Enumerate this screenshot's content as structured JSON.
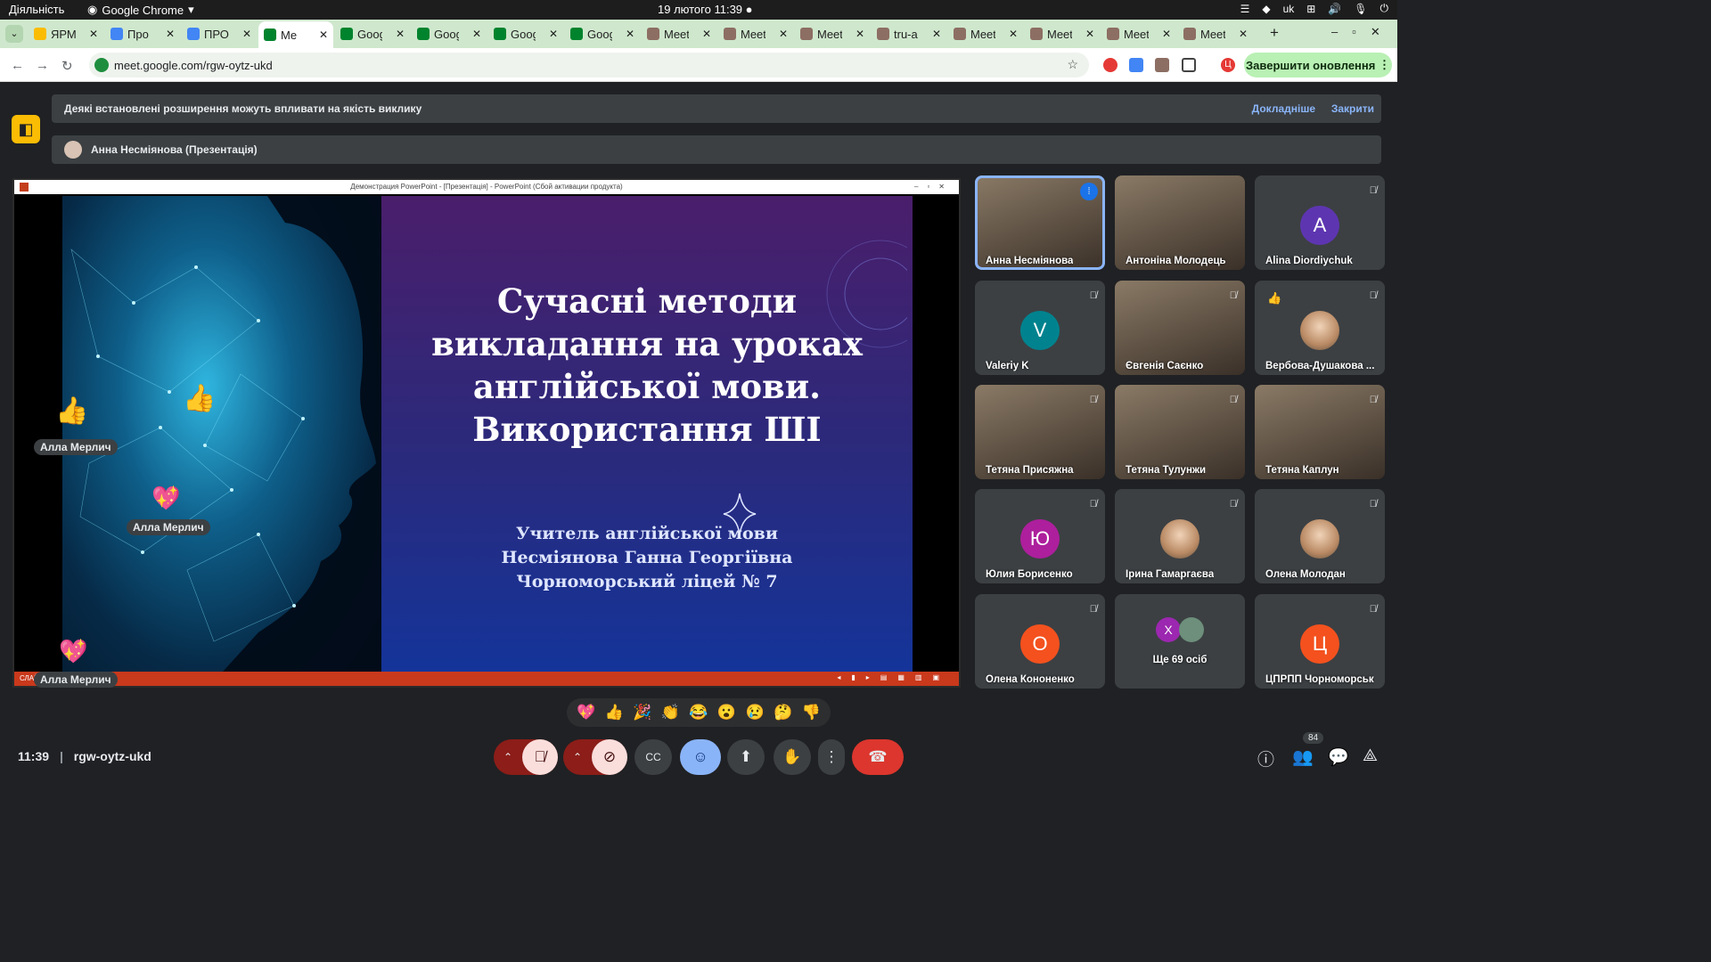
{
  "system": {
    "activities": "Діяльність",
    "app": "Google Chrome",
    "clock": "19 лютого  11:39",
    "lang": "uk"
  },
  "tabs": [
    {
      "title": "ЯРМ",
      "color": "#fbbc04"
    },
    {
      "title": "Про",
      "color": "#4285f4"
    },
    {
      "title": "ПРОІ",
      "color": "#4285f4"
    },
    {
      "title": "Me",
      "color": "#00832d",
      "active": true
    },
    {
      "title": "Goog",
      "color": "#00832d"
    },
    {
      "title": "Goog",
      "color": "#00832d"
    },
    {
      "title": "Goog",
      "color": "#00832d"
    },
    {
      "title": "Goog",
      "color": "#00832d"
    },
    {
      "title": "Meet",
      "color": "#8d6e63"
    },
    {
      "title": "Meet",
      "color": "#8d6e63"
    },
    {
      "title": "Meet",
      "color": "#8d6e63"
    },
    {
      "title": "tru-a",
      "color": "#8d6e63"
    },
    {
      "title": "Meet",
      "color": "#8d6e63"
    },
    {
      "title": "Meet",
      "color": "#8d6e63"
    },
    {
      "title": "Meet",
      "color": "#8d6e63"
    },
    {
      "title": "Meet",
      "color": "#8d6e63"
    }
  ],
  "browser": {
    "url": "meet.google.com/rgw-oytz-ukd",
    "update_label": "Завершити оновлення",
    "profile_letter": "Ц"
  },
  "banner": {
    "text": "Деякі встановлені розширення можуть впливати на якість виклику",
    "more": "Докладніше",
    "close": "Закрити"
  },
  "presenter": {
    "label": "Анна Несміянова (Презентація)"
  },
  "presentation": {
    "window_title": "Демонстрация PowerPoint - [Презентація] - PowerPoint (Сбой активации продукта)",
    "slide_title": [
      "Сучасні методи",
      "викладання на уроках",
      "англійської мови.",
      "Використання ШІ"
    ],
    "slide_subtitle": [
      "Учитель  англійської мови",
      "Несміянова Ганна Георгіївна",
      "Чорноморський ліцей № 7"
    ],
    "status_left": "СЛАЙ"
  },
  "reactions": [
    {
      "emoji": "👍",
      "name": "Алла Мерлич"
    },
    {
      "emoji": "👍",
      "name": ""
    },
    {
      "emoji": "💖",
      "name": "Алла Мерлич"
    },
    {
      "emoji": "💖",
      "name": "Алла Мерлич"
    }
  ],
  "participants": [
    {
      "name": "Анна Несміянова",
      "type": "video",
      "speaking": true
    },
    {
      "name": "Антоніна Молодець",
      "type": "video"
    },
    {
      "name": "Alina Diordiychuk",
      "type": "avatar",
      "letter": "A",
      "color": "#5e35b1",
      "muted": true
    },
    {
      "name": "Valeriy K",
      "type": "avatar",
      "letter": "V",
      "color": "#00838f",
      "muted": true
    },
    {
      "name": "Євгенія Саєнко",
      "type": "video",
      "muted": true
    },
    {
      "name": "Вербова-Душакова ...",
      "type": "photo",
      "muted": true,
      "reaction": "👍"
    },
    {
      "name": "Тетяна Присяжна",
      "type": "video",
      "muted": true
    },
    {
      "name": "Тетяна Тулунжи",
      "type": "video",
      "muted": true
    },
    {
      "name": "Тетяна Каплун",
      "type": "video",
      "muted": true
    },
    {
      "name": "Юлия Борисенко",
      "type": "avatar",
      "letter": "Ю",
      "color": "#ad1f9c",
      "muted": true
    },
    {
      "name": "Ірина Гамаргаєва",
      "type": "photo",
      "muted": true
    },
    {
      "name": "Олена Молодан",
      "type": "photo",
      "muted": true
    },
    {
      "name": "Олена Кононенко",
      "type": "avatar",
      "letter": "О",
      "color": "#f4511e",
      "muted": true
    },
    {
      "name": "Ще 69 осіб",
      "type": "more",
      "letter": "Х"
    },
    {
      "name": "ЦПРПП Чорноморськ",
      "type": "avatar",
      "letter": "Ц",
      "color": "#f4511e",
      "muted": true
    }
  ],
  "emoji_bar": [
    "💖",
    "👍",
    "🎉",
    "👏",
    "😂",
    "😮",
    "😢",
    "🤔",
    "👎"
  ],
  "bottom": {
    "time": "11:39",
    "meeting_code": "rgw-oytz-ukd",
    "participant_count": "84"
  }
}
